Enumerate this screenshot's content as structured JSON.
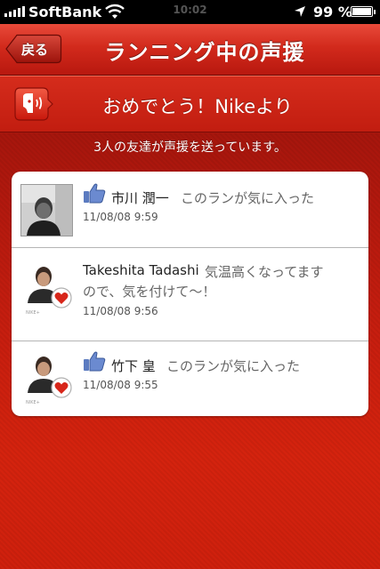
{
  "status_bar": {
    "carrier": "SoftBank",
    "time": "10:02",
    "battery": "99 %"
  },
  "nav": {
    "back_label": "戻る",
    "title": "ランニング中の声援"
  },
  "banner": {
    "text": "おめでとう！Nikeより"
  },
  "friend_count_text": "3人の友達が声援を送っています。",
  "cheers": [
    {
      "name": "市川 潤一",
      "message": "このランが気に入った",
      "time": "11/08/08  9:59"
    },
    {
      "name": "Takeshita Tadashi",
      "message": "気温高くなってますので、気を付けて〜！",
      "message_line1": "気温高くなってます",
      "message_line2": "ので、気を付けて〜！",
      "time": "11/08/08  9:56"
    },
    {
      "name": "竹下 皇",
      "message": "このランが気に入った",
      "time": "11/08/08  9:55"
    }
  ],
  "colors": {
    "brand_red": "#d22a1c",
    "like_blue": "#3b5998"
  }
}
